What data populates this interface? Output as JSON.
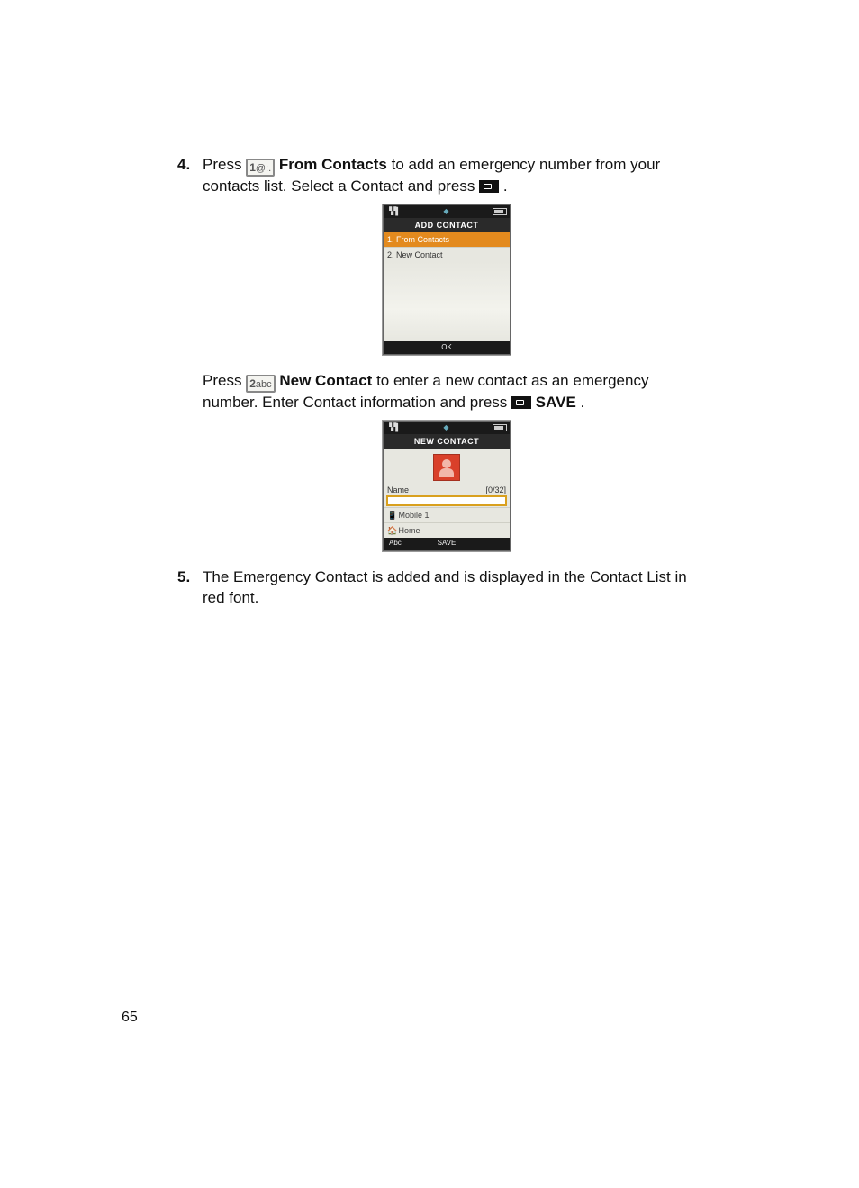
{
  "steps": {
    "4": {
      "para1": {
        "press": "Press ",
        "key": "1@:.",
        "bold": " From Contacts",
        "tail1": " to add an emergency number from your contacts list. Select a Contact and press ",
        "period": "."
      },
      "para2": {
        "press": "Press ",
        "key": "2abc",
        "bold": " New Contact",
        "tail1": " to enter a new contact as an emergency number. Enter Contact information and press ",
        "saveWord": " SAVE",
        "period": "."
      }
    },
    "5": "The Emergency Contact is added and is displayed in the Contact List in red font."
  },
  "phone1": {
    "title": "ADD CONTACT",
    "opt1": "1. From Contacts",
    "opt2": "2. New Contact",
    "softCenter": "OK"
  },
  "phone2": {
    "title": "NEW CONTACT",
    "nameLabel": "Name",
    "counter": "[0/32]",
    "mobile": "Mobile 1",
    "home": "Home",
    "softLeft": "Abc",
    "softCenter": "SAVE"
  },
  "pageNumber": "65"
}
